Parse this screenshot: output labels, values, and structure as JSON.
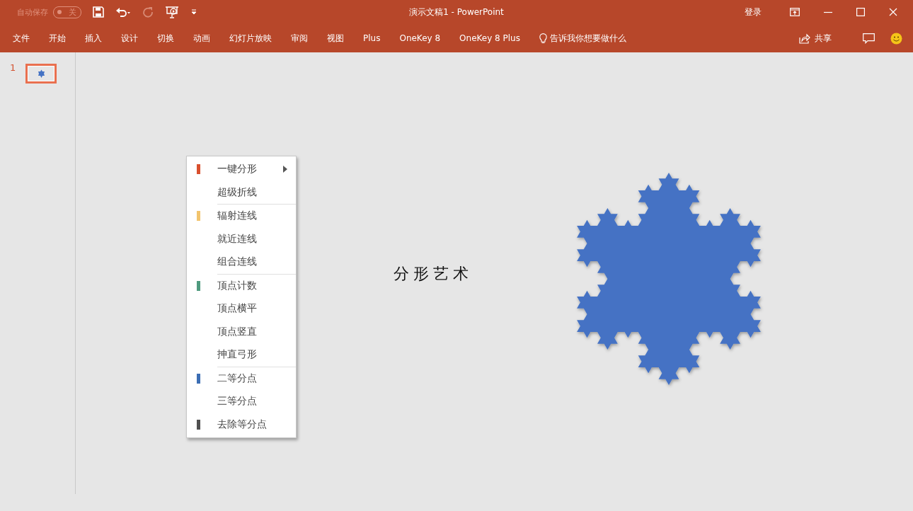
{
  "title_bar": {
    "autosave": {
      "label": "自动保存",
      "toggle_label": "关",
      "on": false
    },
    "title": "演示文稿1  -  PowerPoint",
    "sign_in": "登录"
  },
  "ribbon": {
    "tabs": [
      "文件",
      "开始",
      "插入",
      "设计",
      "切换",
      "动画",
      "幻灯片放映",
      "审阅",
      "视图",
      "Plus",
      "OneKey 8",
      "OneKey 8 Plus"
    ],
    "tell_me": "告诉我你想要做什么",
    "share": "共享"
  },
  "thumbnails": [
    {
      "number": "1",
      "selected": true
    }
  ],
  "slide": {
    "title": "分形艺术"
  },
  "context_menu": {
    "groups": [
      [
        {
          "label": "一键分形",
          "color": "#d9502e",
          "submenu": true
        },
        {
          "label": "超级折线",
          "submenu": false
        }
      ],
      [
        {
          "label": "辐射连线",
          "color": "#f2c46d",
          "submenu": false
        },
        {
          "label": "就近连线",
          "submenu": false
        },
        {
          "label": "组合连线",
          "submenu": false
        }
      ],
      [
        {
          "label": "顶点计数",
          "color": "#4f9a7e",
          "submenu": false
        },
        {
          "label": "顶点横平",
          "submenu": false
        },
        {
          "label": "顶点竖直",
          "submenu": false
        },
        {
          "label": "抻直弓形",
          "submenu": false
        }
      ],
      [
        {
          "label": "二等分点",
          "color": "#3c6eb4",
          "submenu": false
        },
        {
          "label": "三等分点",
          "submenu": false
        },
        {
          "label": "去除等分点",
          "color": "#505050",
          "submenu": false
        }
      ]
    ]
  }
}
